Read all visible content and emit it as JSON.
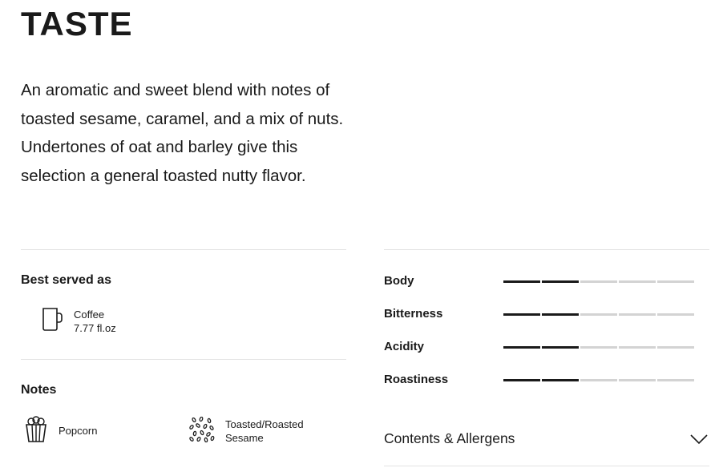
{
  "taste": {
    "title": "TASTE",
    "description": "An aromatic and sweet blend with notes of toasted sesame, caramel, and a mix of nuts. Undertones of oat and barley give this selection a general toasted nutty flavor."
  },
  "best_served": {
    "heading": "Best served as",
    "items": [
      {
        "name": "Coffee",
        "size": "7.77 fl.oz",
        "icon": "coffee-mug-icon"
      }
    ]
  },
  "notes": {
    "heading": "Notes",
    "items": [
      {
        "label": "Popcorn",
        "icon": "popcorn-icon"
      },
      {
        "label_line1": "Toasted/Roasted",
        "label_line2": "Sesame",
        "icon": "sesame-seeds-icon"
      }
    ]
  },
  "attributes": {
    "scale_max": 5,
    "items": [
      {
        "label": "Body",
        "level": 2
      },
      {
        "label": "Bitterness",
        "level": 2
      },
      {
        "label": "Acidity",
        "level": 2
      },
      {
        "label": "Roastiness",
        "level": 2
      }
    ]
  },
  "contents": {
    "label": "Contents & Allergens",
    "icon": "chevron-down-icon"
  },
  "colors": {
    "text": "#1a1a1a",
    "bar_filled": "#1a1a1a",
    "bar_empty": "#d3d3d3",
    "divider": "#e4e4e4"
  }
}
